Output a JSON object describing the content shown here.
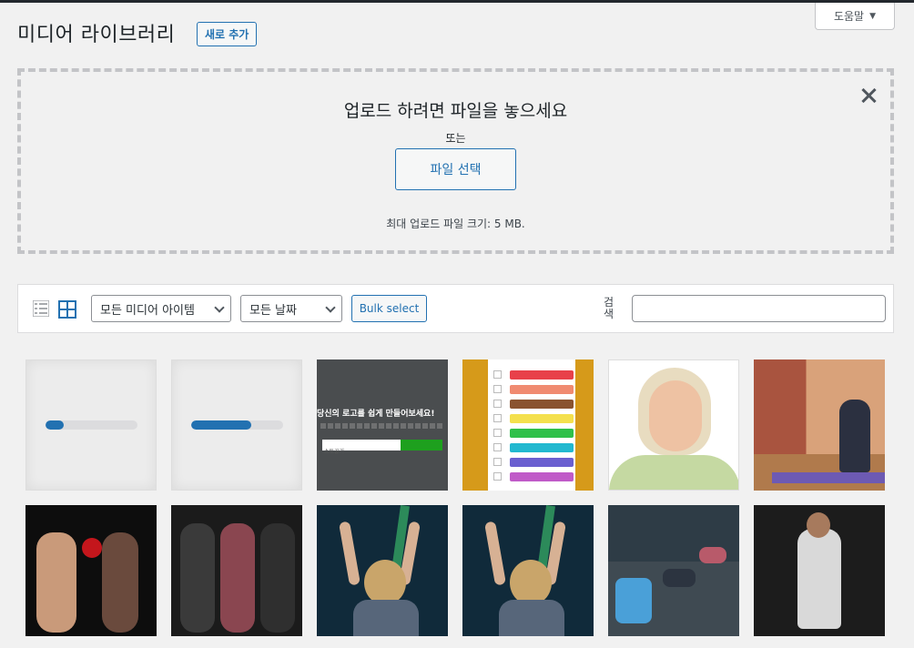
{
  "header": {
    "title": "미디어 라이브러리",
    "add_new_label": "새로 추가",
    "help_label": "도움말"
  },
  "uploader": {
    "drop_title": "업로드 하려면 파일을 놓으세요",
    "or_label": "또는",
    "select_files_label": "파일 선택",
    "max_size_label": "최대 업로드 파일 크기: 5 MB."
  },
  "toolbar": {
    "filter_type": "모든 미디어 아이템",
    "filter_date": "모든 날짜",
    "bulk_select_label": "Bulk select",
    "search_label": "검색",
    "search_value": ""
  },
  "grid": {
    "upload_progress": [
      0.2,
      0.65
    ],
    "thumbnail_text": "당신의 로고를 쉽게 만들어보세요!",
    "thumbnail_field_text": "스토골기"
  },
  "colors": {
    "accent": "#2271b1",
    "background": "#f1f1f1"
  },
  "icons": [
    "list-view-icon",
    "grid-view-icon",
    "close-icon",
    "caret-down-icon",
    "chevron-down-icon"
  ]
}
